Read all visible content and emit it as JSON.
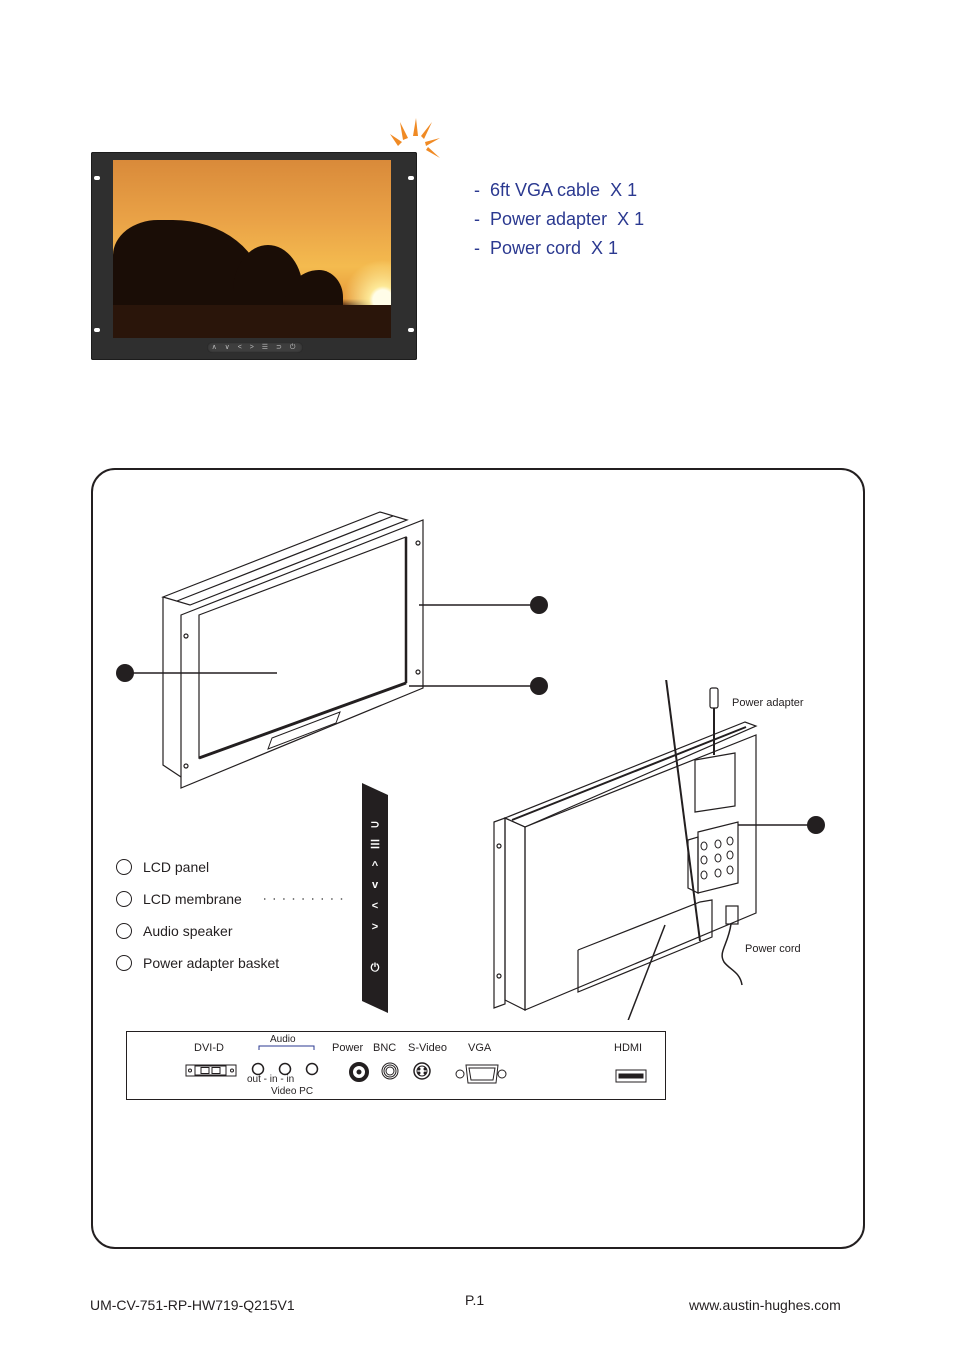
{
  "accessories": {
    "items": [
      "-  6ft VGA cable  X 1",
      "-  Power adapter  X 1",
      "-  Power cord  X 1"
    ],
    "text_color": "#2b3990"
  },
  "photo_monitor": {
    "button_glyphs": "∧ ∨ < > ☰ ⊃  ⏻"
  },
  "diagram": {
    "legend": [
      {
        "label": "LCD panel"
      },
      {
        "label": "LCD membrane"
      },
      {
        "label": "Audio speaker"
      },
      {
        "label": "Power adapter basket"
      }
    ],
    "membrane_buttons": [
      {
        "icon": "return-icon",
        "glyph": "⊃"
      },
      {
        "icon": "menu-icon",
        "glyph": "☰"
      },
      {
        "icon": "up-icon",
        "glyph": "^"
      },
      {
        "icon": "down-icon",
        "glyph": "v"
      },
      {
        "icon": "left-icon",
        "glyph": "<"
      },
      {
        "icon": "right-icon",
        "glyph": ">"
      },
      {
        "icon": "power-icon",
        "glyph": "⏻"
      }
    ],
    "callouts": {
      "power_adapter": "Power adapter",
      "power_cord": "Power cord"
    },
    "connectors": {
      "dvi": "DVI-D",
      "audio": "Audio",
      "audio_sub_top": "out  -  in  -  in",
      "audio_sub_bottom": "Video  PC",
      "power": "Power",
      "bnc": "BNC",
      "svideo": "S-Video",
      "vga": "VGA",
      "hdmi": "HDMI"
    }
  },
  "footer": {
    "doc_code": "UM-CV-751-RP-HW719-Q215V1",
    "page": "P.1",
    "website": "www.austin-hughes.com"
  },
  "colors": {
    "accent_orange": "#f08a24",
    "text_blue": "#2b3990",
    "line": "#231f20"
  }
}
